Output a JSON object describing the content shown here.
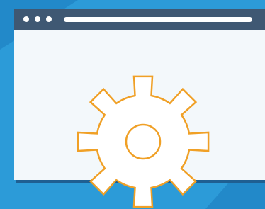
{
  "illustration": {
    "subject": "browser-window-settings",
    "icons": [
      "browser-window-icon",
      "gear-icon"
    ]
  },
  "colors": {
    "background": "#2C9BD8",
    "background_shade": "#2289C9",
    "window_titlebar": "#3F5873",
    "window_frame_dark": "#1F5F92",
    "window_body": "#F3F8FB",
    "window_dots": "#FFFFFF",
    "address_bar": "#FFFFFF",
    "gear_fill": "#FFFFFF",
    "gear_stroke": "#F0A026"
  }
}
